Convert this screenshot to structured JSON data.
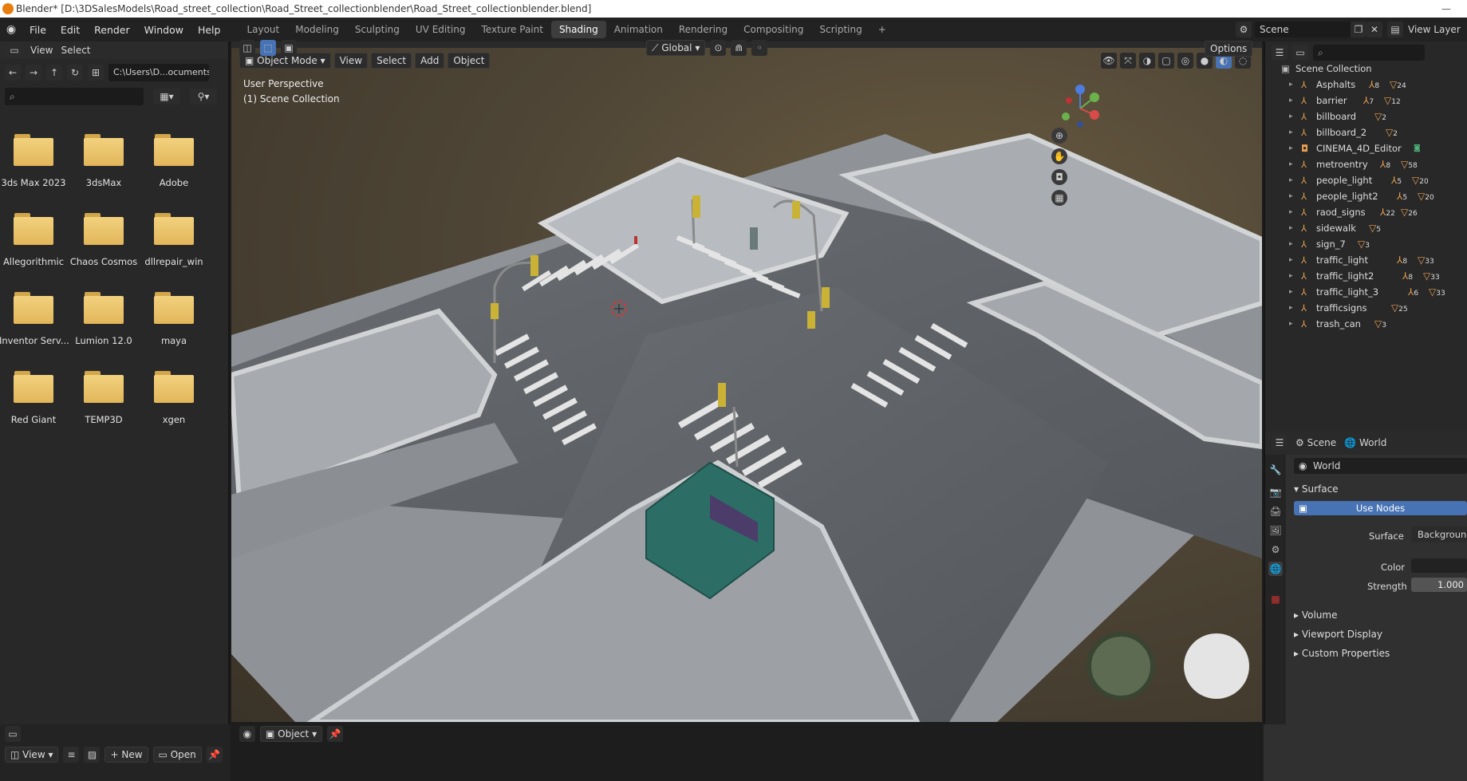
{
  "window": {
    "title": "Blender* [D:\\3DSalesModels\\Road_street_collection\\Road_Street_collectionblender\\Road_Street_collectionblender.blend]"
  },
  "menu": {
    "items": [
      "File",
      "Edit",
      "Render",
      "Window",
      "Help"
    ]
  },
  "workspaces": {
    "tabs": [
      "Layout",
      "Modeling",
      "Sculpting",
      "UV Editing",
      "Texture Paint",
      "Shading",
      "Animation",
      "Rendering",
      "Compositing",
      "Scripting"
    ],
    "active": "Shading"
  },
  "topright": {
    "scene": "Scene",
    "view_layer": "View Layer"
  },
  "filebrowser": {
    "header_view": "View",
    "header_select": "Select",
    "path": "C:\\Users\\D...ocuments\\",
    "folders": [
      "3ds Max 2023",
      "3dsMax",
      "Adobe",
      "Allegorithmic",
      "Chaos Cosmos",
      "dllrepair_win",
      "Inventor Serv...",
      "Lumion 12.0",
      "maya",
      "Red Giant",
      "TEMP3D",
      "xgen"
    ]
  },
  "viewport": {
    "mode": "Object Mode",
    "menus": [
      "View",
      "Select",
      "Add",
      "Object"
    ],
    "orientation": "Global",
    "options": "Options",
    "overlay_line1": "User Perspective",
    "overlay_line2": "(1) Scene Collection",
    "axis": {
      "z": "Z",
      "y": "Y",
      "x": "X"
    }
  },
  "outliner": {
    "root": "Scene Collection",
    "items": [
      {
        "name": "Asphalts",
        "a": "8",
        "b": "24"
      },
      {
        "name": "barrier",
        "a": "7",
        "b": "12"
      },
      {
        "name": "billboard",
        "a": "",
        "b": "2"
      },
      {
        "name": "billboard_2",
        "a": "",
        "b": "2"
      },
      {
        "name": "CINEMA_4D_Editor",
        "a": "",
        "b": ""
      },
      {
        "name": "metroentry",
        "a": "8",
        "b": "58"
      },
      {
        "name": "people_light",
        "a": "5",
        "b": "20"
      },
      {
        "name": "people_light2",
        "a": "5",
        "b": "20"
      },
      {
        "name": "raod_signs",
        "a": "22",
        "b": "26"
      },
      {
        "name": "sidewalk",
        "a": "",
        "b": "5"
      },
      {
        "name": "sign_7",
        "a": "",
        "b": "3"
      },
      {
        "name": "traffic_light",
        "a": "8",
        "b": "33"
      },
      {
        "name": "traffic_light2",
        "a": "8",
        "b": "33"
      },
      {
        "name": "traffic_light_3",
        "a": "6",
        "b": "33"
      },
      {
        "name": "trafficsigns",
        "a": "",
        "b": "25"
      },
      {
        "name": "trash_can",
        "a": "",
        "b": "3"
      }
    ]
  },
  "properties": {
    "scene_tab": "Scene",
    "world_tab": "World",
    "world_name": "World",
    "surface_panel": "Surface",
    "use_nodes": "Use Nodes",
    "surface_label": "Surface",
    "surface_value": "Background",
    "color_label": "Color",
    "strength_label": "Strength",
    "strength_value": "1.000",
    "panels": [
      "Volume",
      "Viewport Display",
      "Custom Properties"
    ]
  },
  "bottom": {
    "object_mode": "Object",
    "view": "View",
    "new": "New",
    "open": "Open"
  },
  "colors": {
    "accent": "#4772b3",
    "folder": "#e8c06a",
    "orange": "#e8a050"
  }
}
